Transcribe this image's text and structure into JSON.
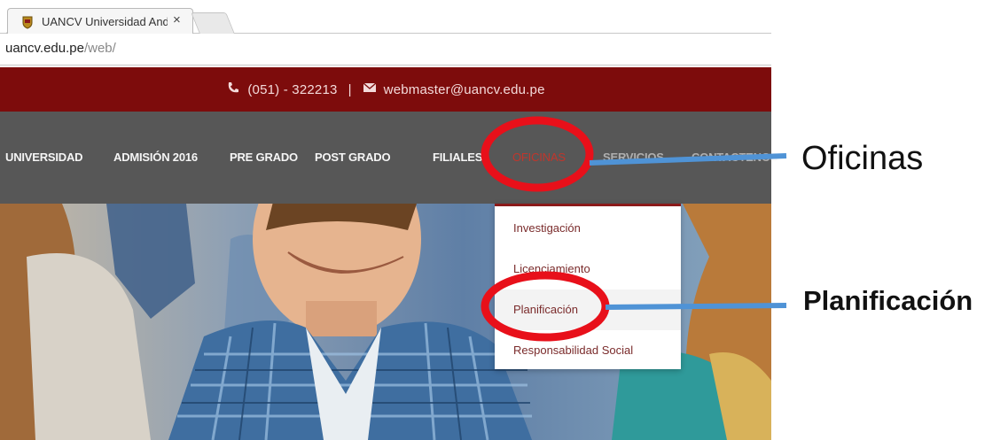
{
  "browser": {
    "tab_title": "UANCV Universidad And",
    "url_host": "uancv.edu.pe",
    "url_path": "/web/"
  },
  "topbar": {
    "phone": "(051) - 322213",
    "separator": "|",
    "email": "webmaster@uancv.edu.pe",
    "icons": [
      "phone-icon",
      "mail-icon"
    ]
  },
  "nav": {
    "items": [
      {
        "label": "UNIVERSIDAD"
      },
      {
        "label": "ADMISIÓN 2016"
      },
      {
        "label": "PRE GRADO"
      },
      {
        "label": "POST GRADO"
      },
      {
        "label": "FILIALES"
      },
      {
        "label": "OFICINAS"
      },
      {
        "label": "SERVICIOS"
      },
      {
        "label": "CONTACTENOS"
      }
    ]
  },
  "dropdown": {
    "items": [
      {
        "label": "Investigación"
      },
      {
        "label": "Licenciamiento"
      },
      {
        "label": "Planificación"
      },
      {
        "label": "Responsabilidad Social"
      }
    ]
  },
  "annotations": {
    "oficinas": "Oficinas",
    "planificacion": "Planificación"
  },
  "colors": {
    "topbar": "#7d0c0c",
    "navbar": "#575757",
    "active_nav": "#c0362c",
    "annotation_red": "#e8101a",
    "annotation_line": "#4f93d6"
  }
}
